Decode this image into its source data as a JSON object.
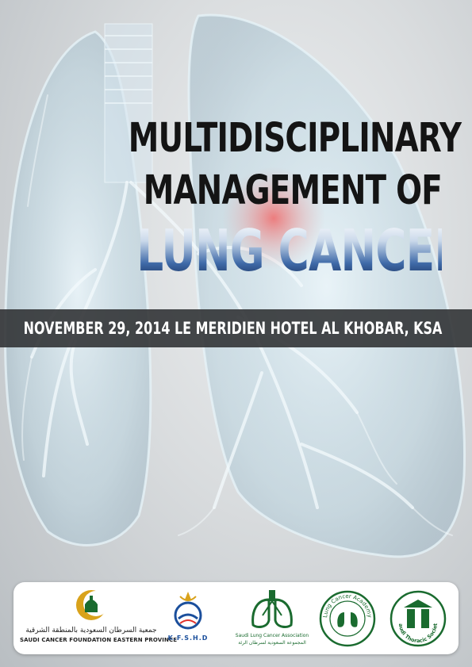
{
  "title": {
    "line1": "MULTIDISCIPLINARY",
    "line2": "MANAGEMENT OF",
    "line3": "LUNG CANCER"
  },
  "event": {
    "details": "NOVEMBER 29, 2014  LE MERIDIEN HOTEL AL KHOBAR, KSA"
  },
  "logos": {
    "sce": {
      "arabic": "جمعية السرطان السعودية بالمنطقة الشرقية",
      "english": "SAUDI CANCER FOUNDATION EASTERN PROVINCE"
    },
    "kfshd": {
      "text": "K.F.S.H.D"
    },
    "slca": {
      "english": "Saudi Lung Cancer Association",
      "arabic": "المجموعة السعودية لسرطان الرئة"
    },
    "lca": {
      "ring_text": "Lung Cancer Academy"
    },
    "sts": {
      "ring_text": "Saudi Thoracic Society"
    }
  },
  "colors": {
    "accent_blue": "#1b3a6b",
    "band": "#323436",
    "logo_green": "#1a6b2f"
  }
}
